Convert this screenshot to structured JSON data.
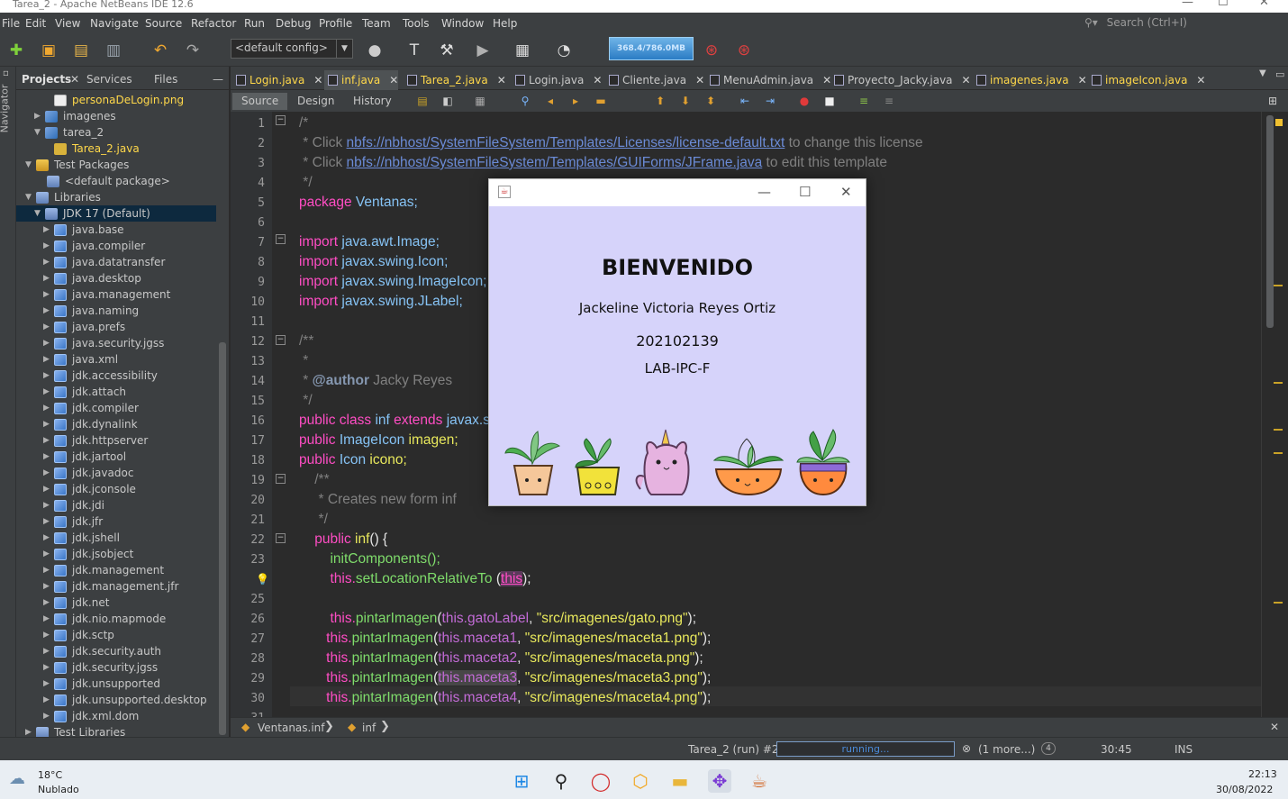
{
  "window": {
    "title": "Tarea_2 - Apache NetBeans IDE 12.6"
  },
  "menu": [
    "File",
    "Edit",
    "View",
    "Navigate",
    "Source",
    "Refactor",
    "Run",
    "Debug",
    "Profile",
    "Team",
    "Tools",
    "Window",
    "Help"
  ],
  "search": {
    "placeholder": "Search (Ctrl+I)"
  },
  "toolbar": {
    "config": "<default config>",
    "memory": "368.4/786.0MB"
  },
  "left_strip": {
    "navigator": "Navigator"
  },
  "project_tabs": [
    "Projects",
    "Services",
    "Files"
  ],
  "tree": [
    {
      "label": "personaDeLogin.png",
      "color": "#ffd84a"
    },
    {
      "label": "imagenes"
    },
    {
      "label": "tarea_2"
    },
    {
      "label": "Tarea_2.java",
      "color": "#ffd84a"
    },
    {
      "label": "Test Packages"
    },
    {
      "label": "<default package>"
    },
    {
      "label": "Libraries"
    },
    {
      "label": "JDK 17 (Default)"
    },
    {
      "label": "java.base"
    },
    {
      "label": "java.compiler"
    },
    {
      "label": "java.datatransfer"
    },
    {
      "label": "java.desktop"
    },
    {
      "label": "java.management"
    },
    {
      "label": "java.naming"
    },
    {
      "label": "java.prefs"
    },
    {
      "label": "java.security.jgss"
    },
    {
      "label": "java.xml"
    },
    {
      "label": "jdk.accessibility"
    },
    {
      "label": "jdk.attach"
    },
    {
      "label": "jdk.compiler"
    },
    {
      "label": "jdk.dynalink"
    },
    {
      "label": "jdk.httpserver"
    },
    {
      "label": "jdk.jartool"
    },
    {
      "label": "jdk.javadoc"
    },
    {
      "label": "jdk.jconsole"
    },
    {
      "label": "jdk.jdi"
    },
    {
      "label": "jdk.jfr"
    },
    {
      "label": "jdk.jshell"
    },
    {
      "label": "jdk.jsobject"
    },
    {
      "label": "jdk.management"
    },
    {
      "label": "jdk.management.jfr"
    },
    {
      "label": "jdk.net"
    },
    {
      "label": "jdk.nio.mapmode"
    },
    {
      "label": "jdk.sctp"
    },
    {
      "label": "jdk.security.auth"
    },
    {
      "label": "jdk.security.jgss"
    },
    {
      "label": "jdk.unsupported"
    },
    {
      "label": "jdk.unsupported.desktop"
    },
    {
      "label": "jdk.xml.dom"
    },
    {
      "label": "Test Libraries"
    }
  ],
  "editor_tabs": [
    "Login.java",
    "inf.java",
    "Tarea_2.java",
    "Login.java",
    "Cliente.java",
    "MenuAdmin.java",
    "Proyecto_Jacky.java",
    "imagenes.java",
    "imageIcon.java"
  ],
  "editor_sub": {
    "source": "Source",
    "design": "Design",
    "history": "History"
  },
  "line_numbers": [
    "1",
    "2",
    "3",
    "4",
    "5",
    "6",
    "7",
    "8",
    "9",
    "10",
    "11",
    "12",
    "13",
    "14",
    "15",
    "16",
    "17",
    "18",
    "19",
    "20",
    "21",
    "22",
    "23",
    "",
    "25",
    "26",
    "27",
    "28",
    "29",
    "30",
    "31"
  ],
  "code": {
    "l1": "/*",
    "l2a": " * Click ",
    "l2b": "nbfs://nbhost/SystemFileSystem/Templates/Licenses/license-default.txt",
    "l2c": " to change this license",
    "l3a": " * Click ",
    "l3b": "nbfs://nbhost/SystemFileSystem/Templates/GUIForms/JFrame.java",
    "l3c": " to edit this template",
    "l4": " */",
    "l5a": "package",
    "l5b": " Ventanas;",
    "l7a": "import",
    "l7b": " java.awt.Image;",
    "l8a": "import",
    "l8b": " javax.swing.Icon;",
    "l9a": "import",
    "l9b": " javax.swing.ImageIcon;",
    "l10a": "import",
    "l10b": " javax.swing.JLabel;",
    "l12": "/**",
    "l13": " *",
    "l14a": " * ",
    "l14b": "@author",
    "l14c": " Jacky Reyes",
    "l15": " */",
    "l16a": "public class ",
    "l16b": "inf",
    "l16c": " extends ",
    "l16d": "javax.s",
    "l17a": "public ",
    "l17b": "ImageIcon",
    "l17c": " imagen;",
    "l18a": "public ",
    "l18b": "Icon",
    "l18c": " icono;",
    "l19": "    /**",
    "l20": "     * Creates new form inf",
    "l21": "     */",
    "l22a": "    public ",
    "l22b": "inf",
    "l22c": "() {",
    "l23": "        initComponents();",
    "l24a": "        this.",
    "l24b": "setLocationRelativeTo",
    "l24c": " (",
    "l24d": "this",
    "l24e": ");",
    "l26a": "        this.",
    "l26b": "pintarImagen",
    "l26c": "(",
    "l26d": "this.gatoLabel",
    "l26e": ", ",
    "l26f": "\"src/imagenes/gato.png\"",
    "l26g": ");",
    "l27a": "       this.",
    "l27b": "pintarImagen",
    "l27c": "(",
    "l27d": "this.maceta1",
    "l27e": ", ",
    "l27f": "\"src/imagenes/maceta1.png\"",
    "l27g": ");",
    "l28a": "       this.",
    "l28b": "pintarImagen",
    "l28c": "(",
    "l28d": "this.maceta2",
    "l28e": ", ",
    "l28f": "\"src/imagenes/maceta.png\"",
    "l28g": ");",
    "l29a": "       this.",
    "l29b": "pintarImagen",
    "l29c": "(",
    "l29d": "this.maceta3",
    "l29e": ", ",
    "l29f": "\"src/imagenes/maceta3.png\"",
    "l29g": ");",
    "l30a": "       this.",
    "l30b": "pintarImagen",
    "l30c": "(",
    "l30d": "this.maceta4",
    "l30e": ", ",
    "l30f": "\"src/imagenes/maceta4.png\"",
    "l30g": ");"
  },
  "breadcrumb": [
    "Ventanas.inf",
    "inf"
  ],
  "status": {
    "run": "Tarea_2 (run) #2",
    "running": "running...",
    "more": "(1 more...)",
    "count": "4",
    "position": "30:45",
    "mode": "INS"
  },
  "dialog": {
    "heading": "BIENVENIDO",
    "name": "Jackeline Victoria Reyes Ortiz",
    "id": "202102139",
    "section": "LAB-IPC-F"
  },
  "taskbar": {
    "temp": "18°C",
    "weather": "Nublado",
    "time": "22:13",
    "date": "30/08/2022"
  }
}
